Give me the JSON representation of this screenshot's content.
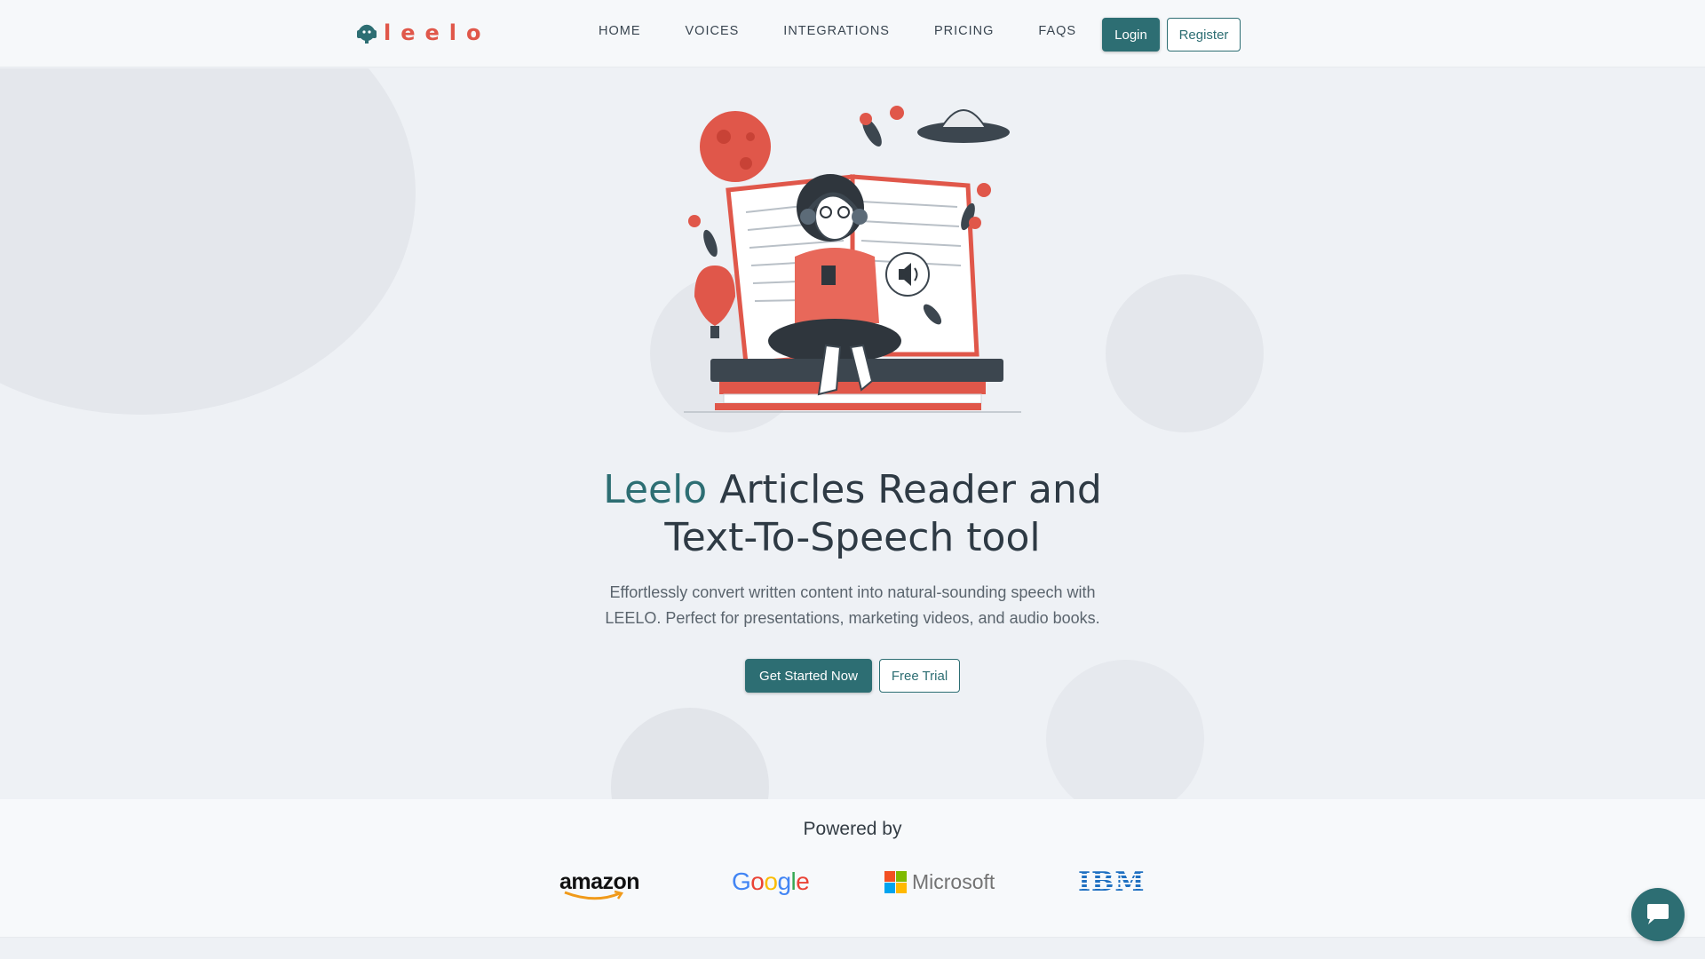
{
  "brand": {
    "name": "leelo",
    "color_primary": "#2d6e73",
    "color_accent": "#e0574a"
  },
  "nav": {
    "items": [
      {
        "label": "HOME"
      },
      {
        "label": "VOICES"
      },
      {
        "label": "INTEGRATIONS"
      },
      {
        "label": "PRICING"
      },
      {
        "label": "FAQS"
      }
    ],
    "login_label": "Login",
    "register_label": "Register"
  },
  "hero": {
    "title_brand": "Leelo",
    "title_line1_rest": " Articles Reader and",
    "title_line2": "Text-To-Speech tool",
    "subtitle_line1": "Effortlessly convert written content into natural-sounding speech with",
    "subtitle_line2": "LEELO. Perfect for presentations, marketing videos, and audio books.",
    "cta_primary": "Get Started Now",
    "cta_secondary": "Free Trial",
    "illustration_icon": "woman-reading-book-with-headphones-illustration"
  },
  "powered_by": {
    "title": "Powered by",
    "partners": [
      {
        "name": "amazon"
      },
      {
        "name": "Google"
      },
      {
        "name": "Microsoft"
      },
      {
        "name": "IBM"
      }
    ]
  },
  "chat": {
    "icon": "chat-bubble-icon"
  }
}
